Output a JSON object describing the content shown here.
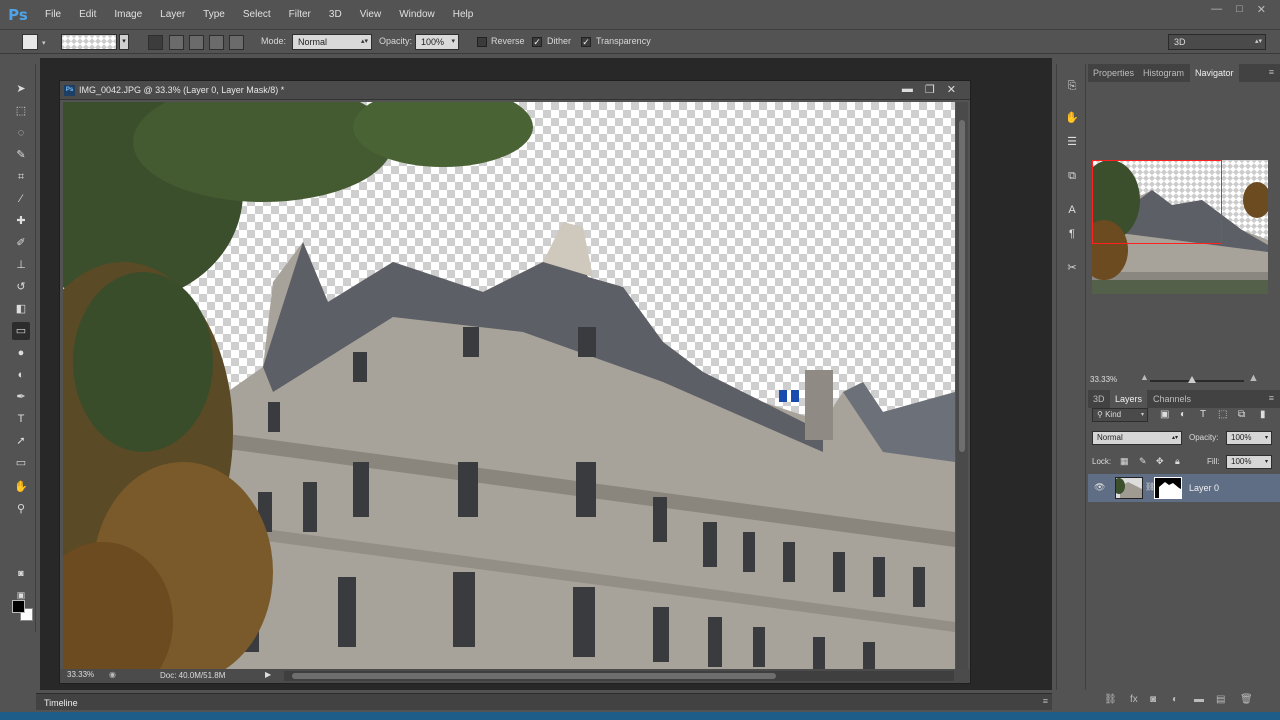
{
  "app": {
    "logo": "Ps",
    "menu": [
      "File",
      "Edit",
      "Image",
      "Layer",
      "Type",
      "Select",
      "Filter",
      "3D",
      "View",
      "Window",
      "Help"
    ],
    "window_controls": [
      "—",
      "□",
      "✕"
    ]
  },
  "options_bar": {
    "mode_label": "Mode:",
    "mode_value": "Normal",
    "opacity_label": "Opacity:",
    "opacity_value": "100%",
    "reverse_label": "Reverse",
    "dither_label": "Dither",
    "transparency_label": "Transparency",
    "reverse_checked": false,
    "dither_checked": true,
    "transparency_checked": true,
    "workspace_value": "3D"
  },
  "document": {
    "title": "IMG_0042.JPG @ 33.3% (Layer 0, Layer Mask/8) *",
    "zoom": "33.33%",
    "doc_size": "Doc: 40.0M/51.8M",
    "icon": "ps-document-icon"
  },
  "tools": [
    {
      "name": "move-tool-icon",
      "glyph": "➤"
    },
    {
      "name": "marquee-tool-icon",
      "glyph": "⬚"
    },
    {
      "name": "lasso-tool-icon",
      "glyph": "◌"
    },
    {
      "name": "quick-selection-tool-icon",
      "glyph": "✎"
    },
    {
      "name": "crop-tool-icon",
      "glyph": "⌗"
    },
    {
      "name": "eyedropper-tool-icon",
      "glyph": "⁄"
    },
    {
      "name": "healing-brush-tool-icon",
      "glyph": "✚"
    },
    {
      "name": "brush-tool-icon",
      "glyph": "✐"
    },
    {
      "name": "clone-stamp-tool-icon",
      "glyph": "⊥"
    },
    {
      "name": "history-brush-tool-icon",
      "glyph": "↺"
    },
    {
      "name": "eraser-tool-icon",
      "glyph": "◧"
    },
    {
      "name": "gradient-tool-icon",
      "glyph": "▭"
    },
    {
      "name": "blur-tool-icon",
      "glyph": "●"
    },
    {
      "name": "dodge-tool-icon",
      "glyph": "◐"
    },
    {
      "name": "pen-tool-icon",
      "glyph": "✒"
    },
    {
      "name": "type-tool-icon",
      "glyph": "T"
    },
    {
      "name": "path-selection-tool-icon",
      "glyph": "➚"
    },
    {
      "name": "shape-tool-icon",
      "glyph": "▭"
    },
    {
      "name": "hand-tool-icon",
      "glyph": "✋"
    },
    {
      "name": "zoom-tool-icon",
      "glyph": "⚲"
    }
  ],
  "panel_tabs_top": [
    "Properties",
    "Histogram",
    "Navigator"
  ],
  "navigator": {
    "zoom": "33.33%"
  },
  "panel_tabs_layers": [
    "3D",
    "Layers",
    "Channels"
  ],
  "layers": {
    "filter_kind": "Kind",
    "blend_mode": "Normal",
    "opacity_label": "Opacity:",
    "opacity_value": "100%",
    "lock_label": "Lock:",
    "fill_label": "Fill:",
    "fill_value": "100%",
    "items": [
      {
        "name": "Layer 0",
        "visible": true,
        "selected": true
      }
    ]
  },
  "strip_icons": [
    "history-icon",
    "actions-icon",
    "adjustments-icon",
    "layer-comps-icon",
    "character-icon",
    "paragraph-icon",
    "tool-presets-icon"
  ],
  "timeline": {
    "label": "Timeline"
  },
  "colors": {
    "accent": "#4fa3e6",
    "selection_rect": "#ff2020",
    "layer_selected": "#5f6e85"
  }
}
